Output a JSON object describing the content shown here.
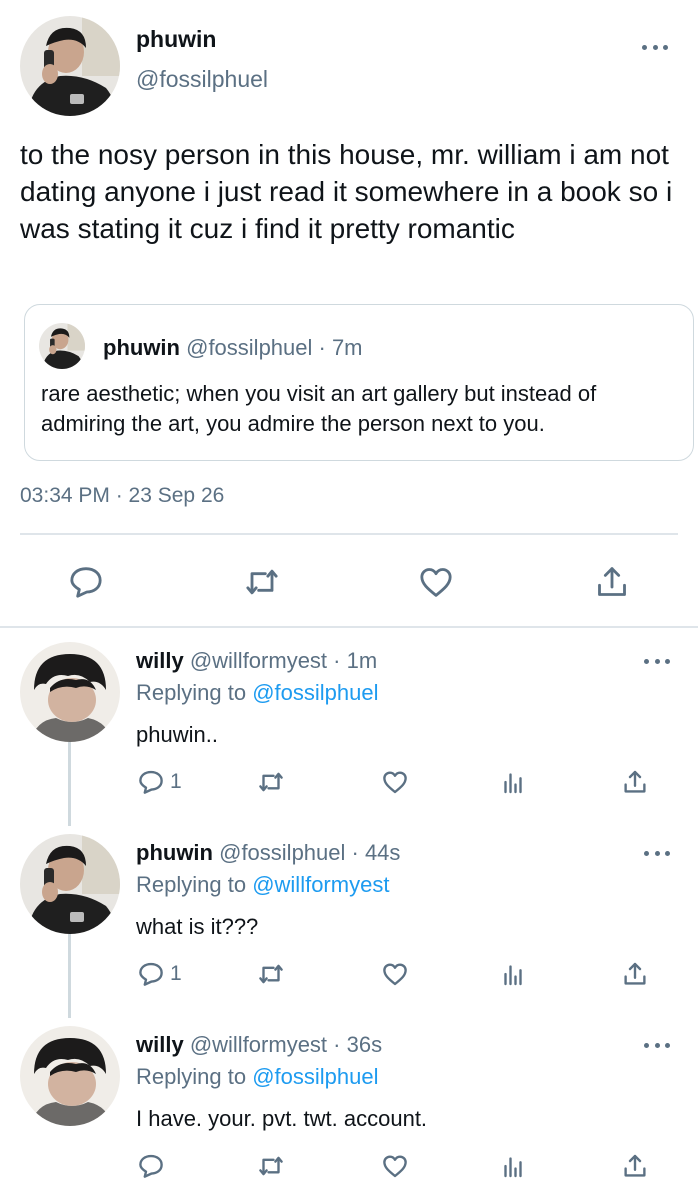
{
  "main_tweet": {
    "name": "phuwin",
    "handle": "@fossilphuel",
    "text": "to the nosy person in this house, mr. william i am not dating anyone i just read it somewhere in a book so i was stating it cuz i find it pretty romantic",
    "quote": {
      "name": "phuwin",
      "meta": "@fossilphuel · 7m",
      "text": "rare aesthetic; when you visit an art gallery but instead of admiring the art, you admire the person next to you."
    },
    "timestamp": "03:34 PM · 23 Sep 26",
    "actions": [
      "reply-icon",
      "retweet-icon",
      "like-icon",
      "share-icon"
    ]
  },
  "replies": [
    {
      "name": "willy",
      "meta": "@willformyest · 1m",
      "replying_label": "Replying to",
      "replying_to": "@fossilphuel",
      "text": "phuwin..",
      "reply_count": "1"
    },
    {
      "name": "phuwin",
      "meta": "@fossilphuel · 44s",
      "replying_label": "Replying to",
      "replying_to": "@willformyest",
      "text": "what is it???",
      "reply_count": "1"
    },
    {
      "name": "willy",
      "meta": "@willformyest · 36s",
      "replying_label": "Replying to",
      "replying_to": "@fossilphuel",
      "text": "I have. your. pvt. twt. account.",
      "reply_count": ""
    }
  ],
  "colors": {
    "text": "#0f1419",
    "secondary": "#5b7083",
    "link": "#1d9bf0",
    "divider": "#dfe5ea"
  }
}
